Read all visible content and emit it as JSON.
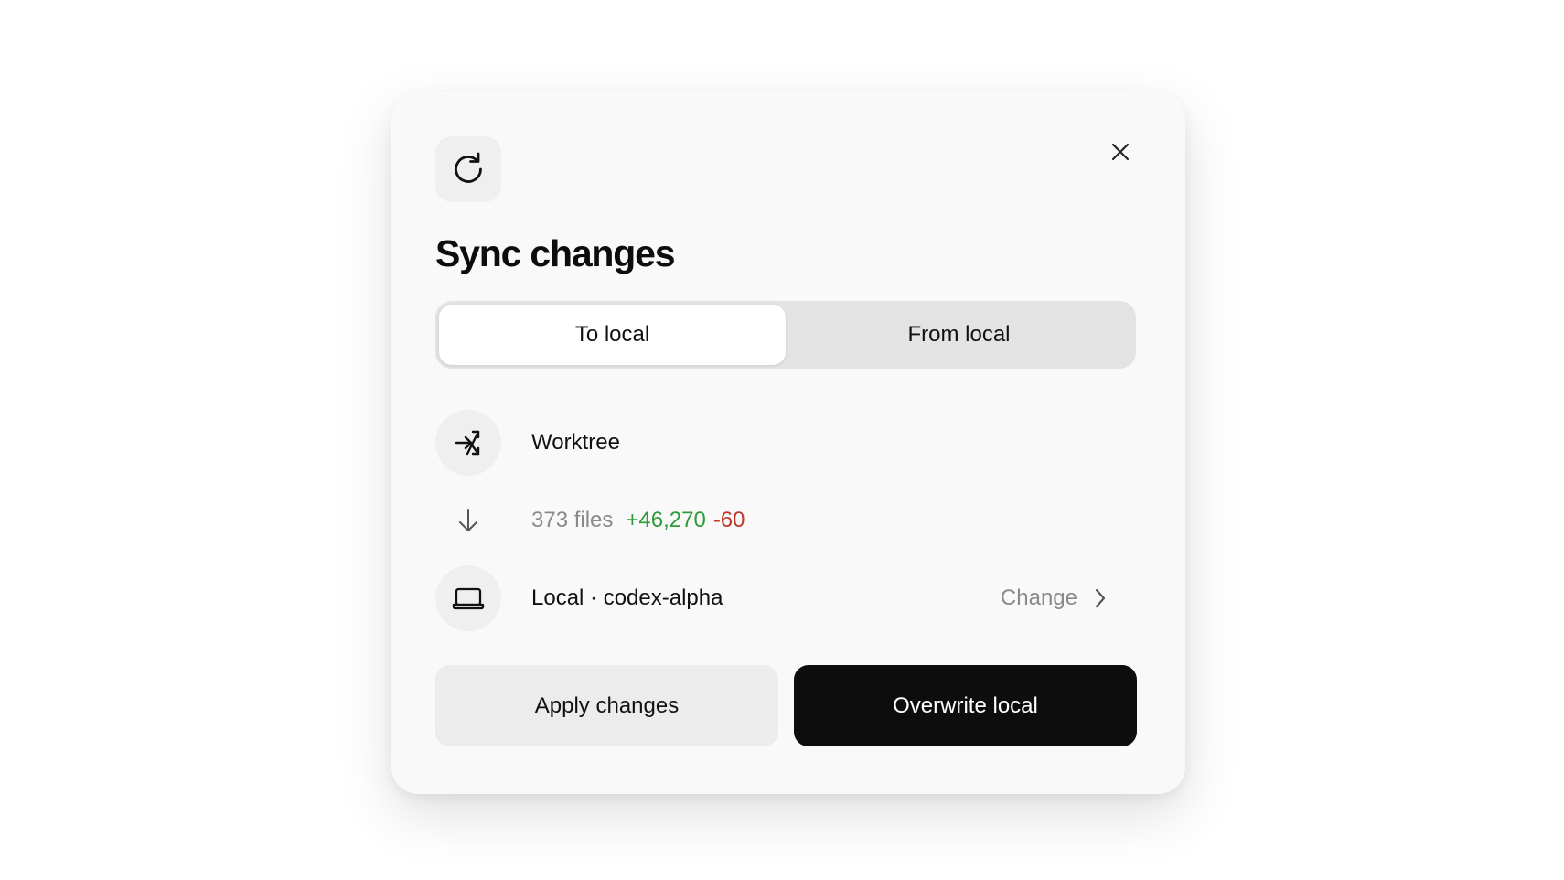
{
  "dialog": {
    "title": "Sync changes",
    "hero_icon": "refresh-icon",
    "close_icon": "close-icon"
  },
  "tabs": [
    {
      "label": "To local",
      "active": true
    },
    {
      "label": "From local",
      "active": false
    }
  ],
  "source": {
    "label": "Worktree",
    "icon": "worktree-branch-icon"
  },
  "diff": {
    "icon": "arrow-down-icon",
    "files": "373 files",
    "additions": "+46,270",
    "deletions": "-60",
    "additions_color": "#2e9b3a",
    "deletions_color": "#c0392b"
  },
  "target": {
    "label": "Local · codex-alpha",
    "icon": "laptop-icon",
    "change_label": "Change",
    "change_icon": "chevron-right-icon"
  },
  "actions": {
    "secondary_label": "Apply changes",
    "primary_label": "Overwrite local"
  }
}
